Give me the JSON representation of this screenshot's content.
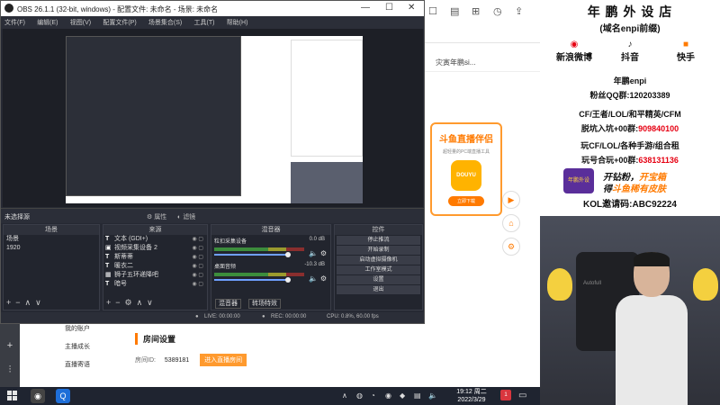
{
  "obs": {
    "title": "OBS 26.1.1 (32-bit, windows) - 配置文件: 未命名 - 场景: 未命名",
    "menu": [
      "文件(F)",
      "编辑(E)",
      "视图(V)",
      "配置文件(P)",
      "场景集合(S)",
      "工具(T)",
      "帮助(H)"
    ],
    "source_status": "未选择源",
    "props_label": "属性",
    "filters_label": "滤镜",
    "scenes": {
      "title": "场景",
      "items": [
        "场景",
        "1920"
      ]
    },
    "sources": {
      "title": "来源",
      "items": [
        "文本 (GDI+)",
        "视频采集设备 2",
        "斯蒂蒂",
        "暖衣二",
        "狮子五环递降吧",
        "暗号"
      ]
    },
    "mixer": {
      "title": "混音器",
      "channels": [
        {
          "name": "粒扣采集设备",
          "level": "0.0 dB"
        },
        {
          "name": "桌面音频",
          "level": "-10.3 dB"
        }
      ],
      "tabs": [
        "混音器",
        "转场特效"
      ]
    },
    "controls": {
      "title": "控件",
      "buttons": [
        "停止推流",
        "开始录制",
        "启动虚拟摄像机",
        "工作室模式",
        "设置",
        "退出"
      ]
    },
    "status": {
      "live": "LIVE: 00:00:00",
      "rec": "REC: 00:00:00",
      "cpu": "CPU: 0.8%, 60.00 fps"
    }
  },
  "web": {
    "user": "灾寅年鹏si...",
    "promo_title": "斗鱼直播伴侣",
    "promo_sub": "超轻量的PC端直播工具",
    "promo_logo": "DOUYU",
    "promo_button": "立即下载",
    "menu": [
      "我的账户",
      "主播成长",
      "直播寄语"
    ],
    "room_title": "房间设置",
    "room_id_label": "房间ID:",
    "room_id": "5389181",
    "room_button": "进入直播房间"
  },
  "banner": {
    "title": "年 鹏 外 设 店",
    "subtitle": "(域名enpi前缀)",
    "socials": [
      {
        "label": "新浪微博",
        "icon": "weibo-icon"
      },
      {
        "label": "抖音",
        "icon": "douyin-icon"
      },
      {
        "label": "快手",
        "icon": "kuaishou-icon"
      }
    ],
    "handle": "年鹏enpi",
    "fans_label": "粉丝QQ群:",
    "fans_qq": "120203389",
    "line1": "CF/王者/LOL/和平精英/CFM",
    "line2_prefix": "脱坑入坑+00群:",
    "line2_num": "909840100",
    "line3": "玩CF/LOL/各种手游/组合租",
    "line4_prefix": "玩号合玩+00群:",
    "line4_num": "638131136",
    "ad_logo": "年鹏外设",
    "ad1_a": "开钻粉，",
    "ad1_b": "开宝箱",
    "ad2_a": "得",
    "ad2_b": "斗鱼稀有皮肤",
    "kol_label": "KOL邀请码:",
    "kol_code": "ABC92224"
  },
  "cam": {
    "chair_brand": "Autofull"
  },
  "taskbar": {
    "time": "19:12 周二",
    "date": "2022/3/29",
    "notif": "1"
  },
  "colors": {
    "accent": "#ff7a00",
    "red": "#e60012",
    "obs_bg": "#262933"
  }
}
